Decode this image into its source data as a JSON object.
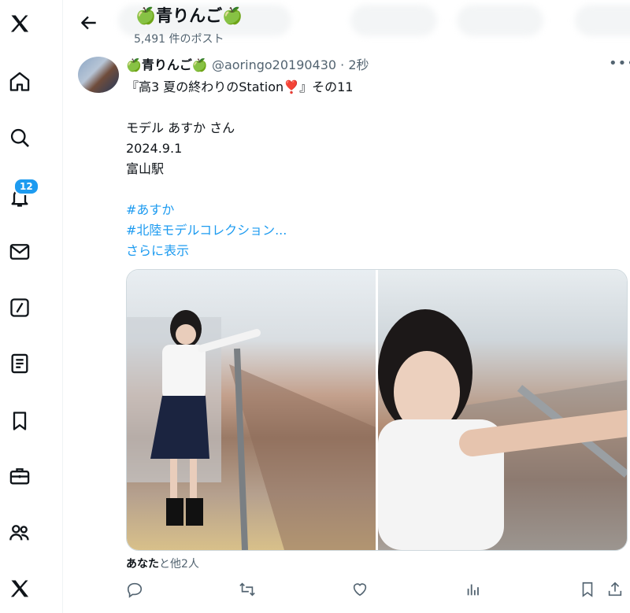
{
  "sidebar": {
    "icons": [
      "x-logo-icon",
      "home-icon",
      "search-icon",
      "notifications-icon",
      "messages-icon",
      "grok-icon",
      "lists-icon",
      "bookmarks-icon",
      "jobs-icon",
      "communities-icon",
      "premium-icon"
    ],
    "notification_count": "12"
  },
  "header": {
    "title": "🍏青りんご🍏",
    "post_count": "5,491 件のポスト"
  },
  "tweet": {
    "author_name": "🍏青りんご🍏",
    "handle_time": "@aoringo20190430 · 2秒",
    "lines": [
      "『高3 夏の終わりのStation❣️』その11",
      "",
      "モデル あすか さん",
      "2024.9.1",
      "富山駅",
      "",
      "#あすか",
      "#北陸モデルコレクション...",
      "さらに表示"
    ],
    "liked_by_bold": "あなた",
    "liked_by_rest": "と他2人"
  },
  "colors": {
    "accent": "#1d9bf0",
    "text": "#0f1419",
    "muted": "#536471"
  }
}
